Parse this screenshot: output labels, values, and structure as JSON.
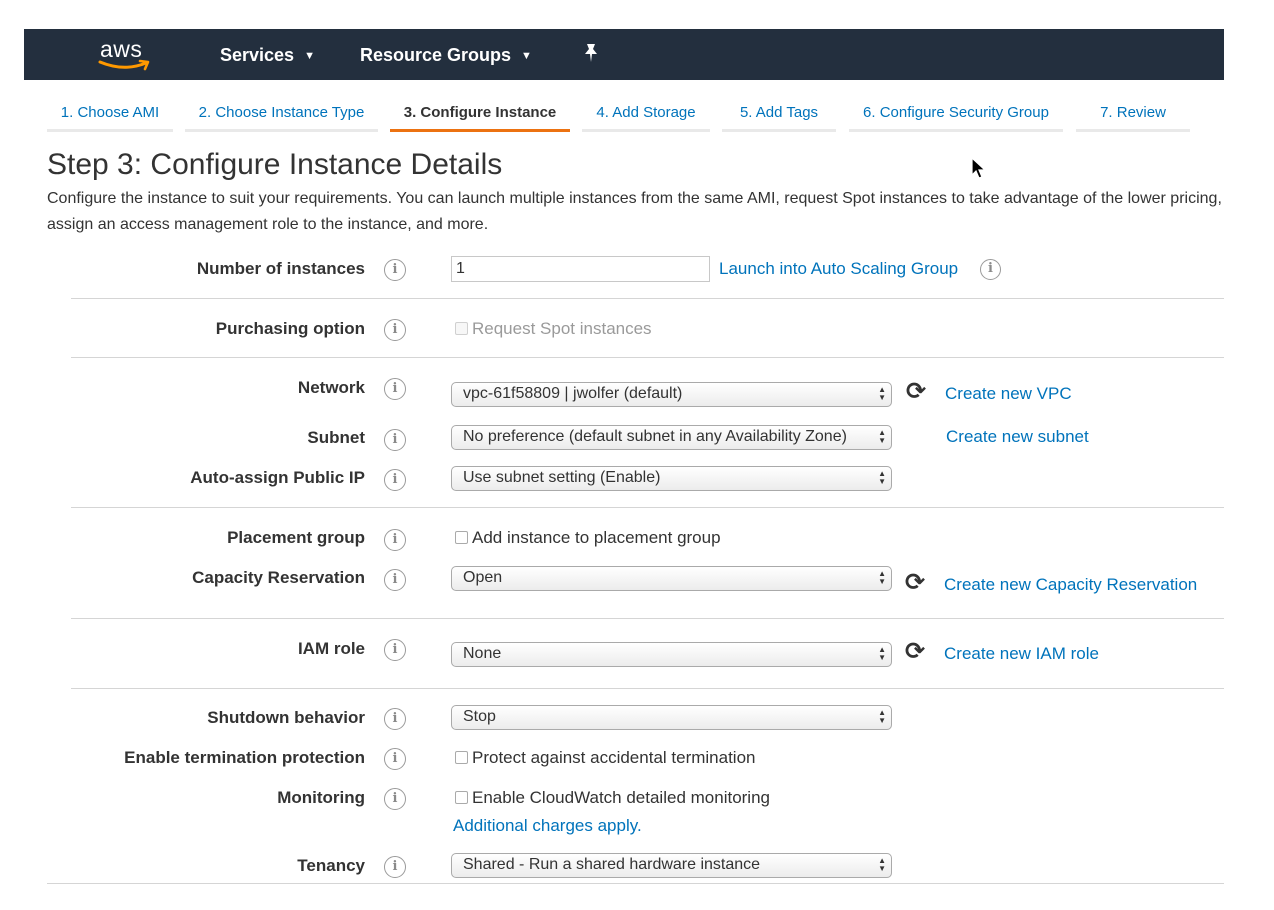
{
  "nav": {
    "logo_text": "aws",
    "services_label": "Services",
    "resource_groups_label": "Resource Groups"
  },
  "wizard_tabs": [
    {
      "label": "1. Choose AMI",
      "active": false
    },
    {
      "label": "2. Choose Instance Type",
      "active": false
    },
    {
      "label": "3. Configure Instance",
      "active": true
    },
    {
      "label": "4. Add Storage",
      "active": false
    },
    {
      "label": "5. Add Tags",
      "active": false
    },
    {
      "label": "6. Configure Security Group",
      "active": false
    },
    {
      "label": "7. Review",
      "active": false
    }
  ],
  "page": {
    "title": "Step 3: Configure Instance Details",
    "description": "Configure the instance to suit your requirements. You can launch multiple instances from the same AMI, request Spot instances to take advantage of the lower pricing, assign an access management role to the instance, and more."
  },
  "info_glyph": "i",
  "refresh_glyph": "⟳",
  "form": {
    "number_of_instances": {
      "label": "Number of instances",
      "value": "1",
      "link": "Launch into Auto Scaling Group"
    },
    "purchasing_option": {
      "label": "Purchasing option",
      "checkbox_label": "Request Spot instances"
    },
    "network": {
      "label": "Network",
      "selected": "vpc-61f58809 | jwolfer (default)",
      "link": "Create new VPC"
    },
    "subnet": {
      "label": "Subnet",
      "selected": "No preference (default subnet in any Availability Zone)",
      "link": "Create new subnet"
    },
    "auto_assign_ip": {
      "label": "Auto-assign Public IP",
      "selected": "Use subnet setting (Enable)"
    },
    "placement_group": {
      "label": "Placement group",
      "checkbox_label": "Add instance to placement group"
    },
    "capacity_reservation": {
      "label": "Capacity Reservation",
      "selected": "Open",
      "link": "Create new Capacity Reservation"
    },
    "iam_role": {
      "label": "IAM role",
      "selected": "None",
      "link": "Create new IAM role"
    },
    "shutdown_behavior": {
      "label": "Shutdown behavior",
      "selected": "Stop"
    },
    "termination_protection": {
      "label": "Enable termination protection",
      "checkbox_label": "Protect against accidental termination"
    },
    "monitoring": {
      "label": "Monitoring",
      "checkbox_label": "Enable CloudWatch detailed monitoring",
      "link": "Additional charges apply."
    },
    "tenancy": {
      "label": "Tenancy",
      "selected": "Shared - Run a shared hardware instance"
    }
  }
}
